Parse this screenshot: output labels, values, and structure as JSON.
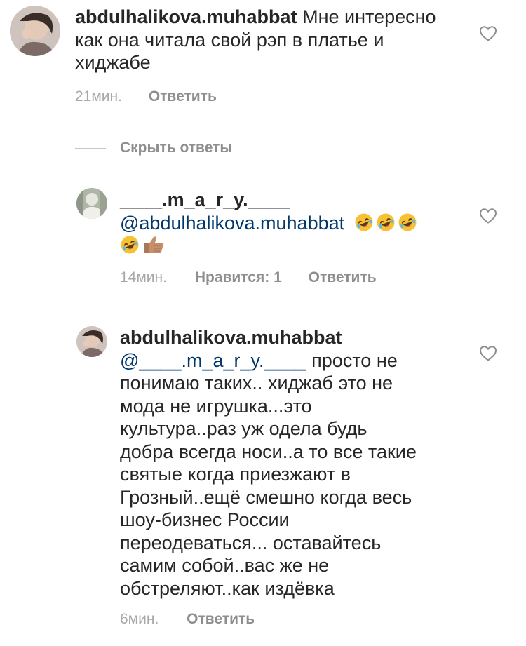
{
  "comments": [
    {
      "username": "abdulhalikova.muhabbat",
      "text": "Мне интересно как она читала свой рэп в платье и хиджабе",
      "time": "21мин.",
      "reply_label": "Ответить"
    }
  ],
  "hide_replies_label": "Скрыть ответы",
  "replies": [
    {
      "username": "____.m_a_r_y.____",
      "mention": "@abdulhalikova.muhabbat",
      "emojis": [
        "rolling-on-floor-laughing",
        "rolling-on-floor-laughing",
        "rolling-on-floor-laughing",
        "rolling-on-floor-laughing",
        "thumbs-up-medium-skin-tone"
      ],
      "time": "14мин.",
      "likes_label": "Нравится: 1",
      "reply_label": "Ответить"
    },
    {
      "username": "abdulhalikova.muhabbat",
      "mention": "@____.m_a_r_y.____",
      "text_lines": [
        " просто не",
        "понимаю таких.. хиджаб это не",
        "мода не игрушка...это",
        "культура..раз уж одела будь",
        "добра всегда носи..а то все такие",
        "святые когда приезжают в",
        "Грозный..ещё смешно когда весь",
        "шоу-бизнес России",
        "переодеваться... оставайтесь",
        "самим собой..вас же не",
        "обстреляют..как издёвка"
      ],
      "time": "6мин.",
      "reply_label": "Ответить"
    }
  ],
  "icons": {
    "like": "heart-outline-icon",
    "emoji_laugh": "rolling-on-floor-laughing",
    "emoji_thumb": "thumbs-up-medium-skin-tone"
  },
  "colors": {
    "text": "#262626",
    "mention": "#00376b",
    "meta": "#8e8e8e",
    "divider": "#c7c7c7"
  }
}
